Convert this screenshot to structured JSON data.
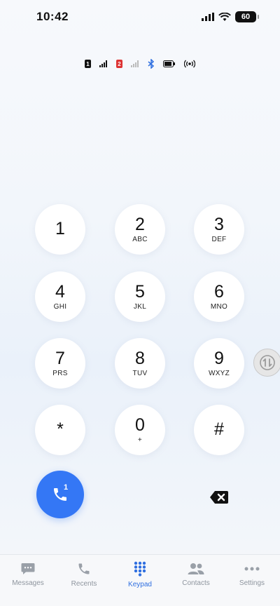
{
  "status_bar": {
    "time": "10:42",
    "battery": "60"
  },
  "keypad": {
    "keys": [
      {
        "digit": "1",
        "letters": ""
      },
      {
        "digit": "2",
        "letters": "ABC"
      },
      {
        "digit": "3",
        "letters": "DEF"
      },
      {
        "digit": "4",
        "letters": "GHI"
      },
      {
        "digit": "5",
        "letters": "JKL"
      },
      {
        "digit": "6",
        "letters": "MNO"
      },
      {
        "digit": "7",
        "letters": "PRS"
      },
      {
        "digit": "8",
        "letters": "TUV"
      },
      {
        "digit": "9",
        "letters": "WXYZ"
      },
      {
        "digit": "*",
        "letters": ""
      },
      {
        "digit": "0",
        "letters": "+"
      },
      {
        "digit": "#",
        "letters": ""
      }
    ]
  },
  "call": {
    "sim_number": "1",
    "color": "#3477f5"
  },
  "nav": {
    "items": [
      {
        "label": "Messages",
        "icon": "message-icon"
      },
      {
        "label": "Recents",
        "icon": "phone-icon"
      },
      {
        "label": "Keypad",
        "icon": "keypad-icon"
      },
      {
        "label": "Contacts",
        "icon": "contacts-icon"
      },
      {
        "label": "Settings",
        "icon": "more-icon"
      }
    ],
    "active": "Keypad",
    "active_color": "#2f6fe0",
    "inactive_color": "#8e959e"
  }
}
